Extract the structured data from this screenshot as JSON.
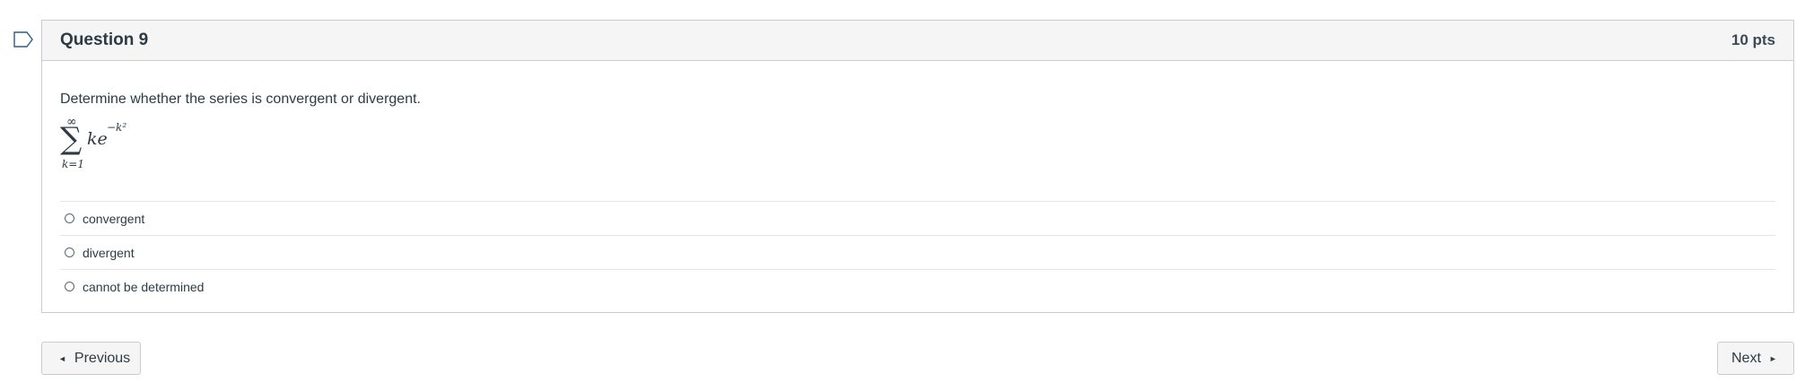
{
  "question": {
    "title": "Question 9",
    "points": "10 pts",
    "text": "Determine whether the series is convergent or divergent.",
    "formula": {
      "upper": "∞",
      "sigma": "∑",
      "lower": "k=1",
      "term": "ke",
      "exponent": "−k²"
    },
    "answers": [
      {
        "label": "convergent"
      },
      {
        "label": "divergent"
      },
      {
        "label": "cannot be determined"
      }
    ]
  },
  "nav": {
    "previous_label": "Previous",
    "next_label": "Next",
    "prev_arrow": "◄",
    "next_arrow": "►"
  }
}
